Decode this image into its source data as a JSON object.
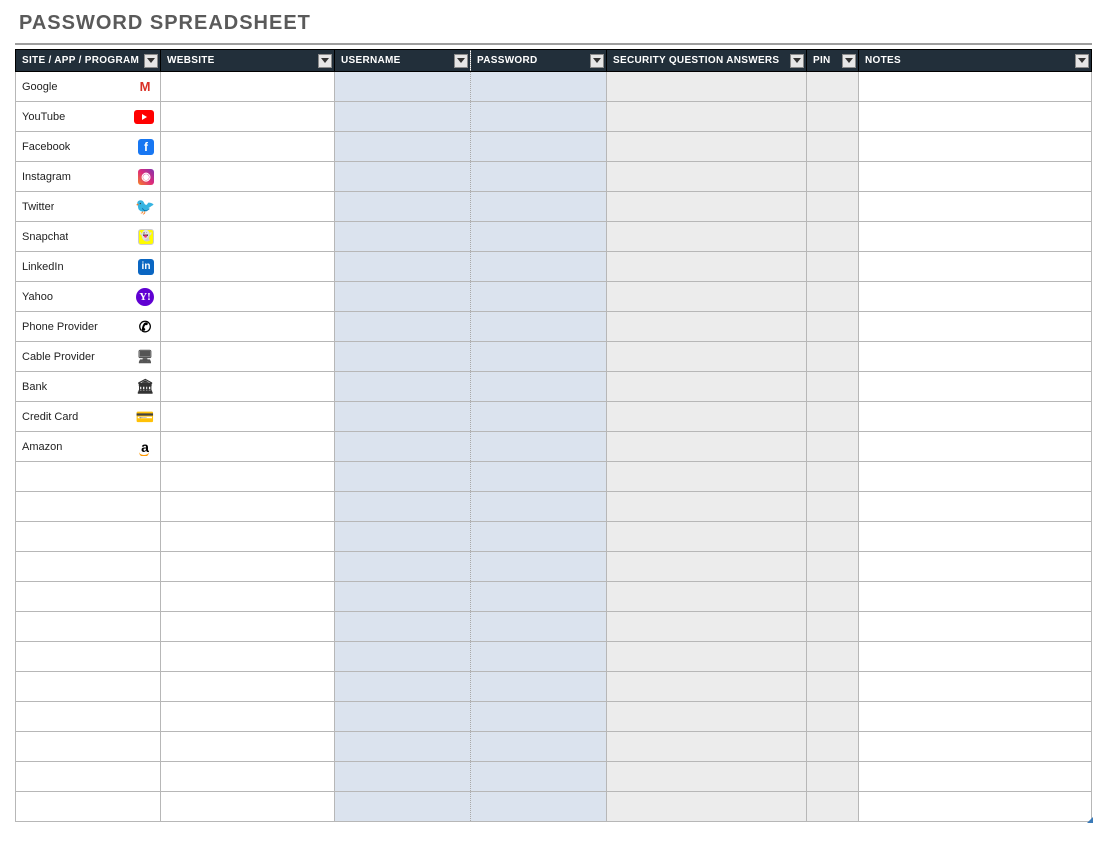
{
  "title": "PASSWORD SPREADSHEET",
  "columns": {
    "site": "SITE / APP / PROGRAM",
    "website": "WEBSITE",
    "username": "USERNAME",
    "password": "PASSWORD",
    "security": "SECURITY QUESTION ANSWERS",
    "pin": "PIN",
    "notes": "NOTES"
  },
  "rows": [
    {
      "site": "Google",
      "icon": "google"
    },
    {
      "site": "YouTube",
      "icon": "youtube"
    },
    {
      "site": "Facebook",
      "icon": "facebook"
    },
    {
      "site": "Instagram",
      "icon": "instagram"
    },
    {
      "site": "Twitter",
      "icon": "twitter"
    },
    {
      "site": "Snapchat",
      "icon": "snapchat"
    },
    {
      "site": "LinkedIn",
      "icon": "linkedin"
    },
    {
      "site": "Yahoo",
      "icon": "yahoo"
    },
    {
      "site": "Phone Provider",
      "icon": "phone"
    },
    {
      "site": "Cable Provider",
      "icon": "cable"
    },
    {
      "site": "Bank",
      "icon": "bank"
    },
    {
      "site": "Credit Card",
      "icon": "credit"
    },
    {
      "site": "Amazon",
      "icon": "amazon"
    },
    {
      "site": ""
    },
    {
      "site": ""
    },
    {
      "site": ""
    },
    {
      "site": ""
    },
    {
      "site": ""
    },
    {
      "site": ""
    },
    {
      "site": ""
    },
    {
      "site": ""
    },
    {
      "site": ""
    },
    {
      "site": ""
    },
    {
      "site": ""
    },
    {
      "site": ""
    }
  ]
}
